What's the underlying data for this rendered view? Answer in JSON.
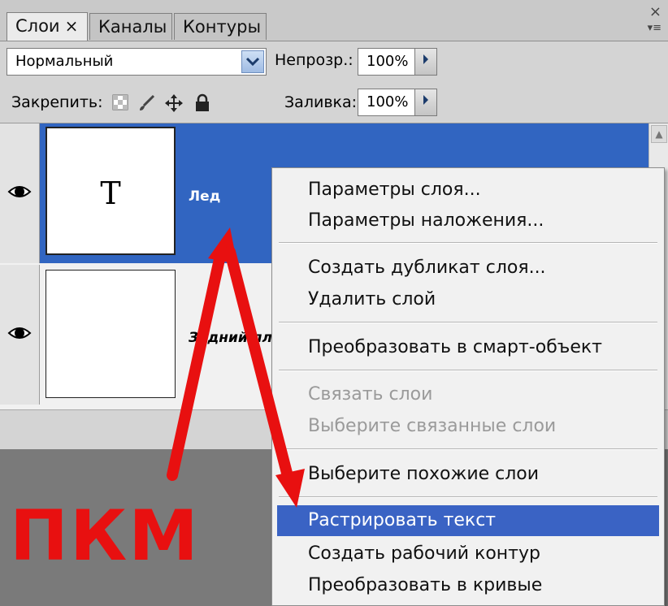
{
  "tabs": [
    {
      "label": "Слои",
      "close": "×"
    },
    {
      "label": "Каналы"
    },
    {
      "label": "Контуры"
    }
  ],
  "window": {
    "close": "×",
    "menu": "▾≡"
  },
  "blend": {
    "mode": "Нормальный",
    "opacity_label": "Непрозр.:",
    "opacity_value": "100%"
  },
  "lock": {
    "label": "Закрепить:",
    "fill_label": "Заливка:",
    "fill_value": "100%"
  },
  "layers": [
    {
      "name": "Лед",
      "thumb": "T",
      "selected": true
    },
    {
      "name": "Задний пл",
      "thumb": "",
      "selected": false
    }
  ],
  "context_menu": [
    {
      "label": "Параметры слоя...",
      "state": "normal"
    },
    {
      "label": "Параметры наложения...",
      "state": "normal"
    },
    {
      "label": "Создать дубликат слоя...",
      "state": "normal"
    },
    {
      "label": "Удалить слой",
      "state": "normal"
    },
    {
      "label": "Преобразовать в смарт-объект",
      "state": "normal"
    },
    {
      "label": "Связать слои",
      "state": "disabled"
    },
    {
      "label": "Выберите связанные слои",
      "state": "disabled"
    },
    {
      "label": "Выберите похожие слои",
      "state": "normal"
    },
    {
      "label": "Растрировать текст",
      "state": "highlighted"
    },
    {
      "label": "Создать рабочий контур",
      "state": "normal"
    },
    {
      "label": "Преобразовать в кривые",
      "state": "normal"
    }
  ],
  "annotation": {
    "text": "ПКМ",
    "color": "#e81010"
  },
  "colors": {
    "selection": "#3165c1",
    "menu_highlight": "#3a63c4",
    "arrow": "#e81010"
  }
}
